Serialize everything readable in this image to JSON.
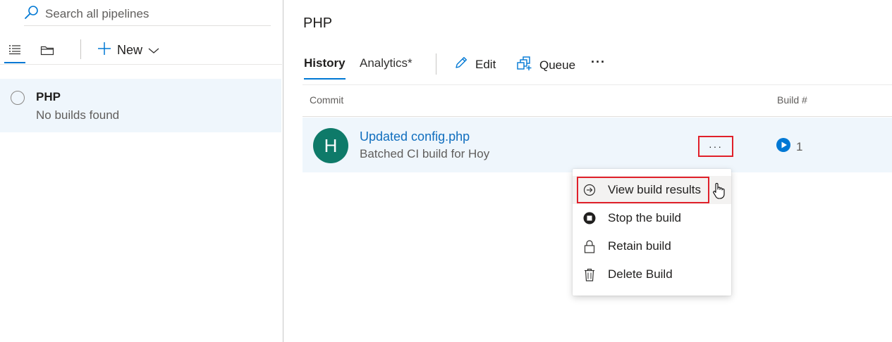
{
  "left_pane": {
    "search": {
      "placeholder": "Search all pipelines",
      "icon": "search-icon"
    },
    "view_toggles": [
      {
        "name": "list-view",
        "icon": "list-icon",
        "active": true
      },
      {
        "name": "folder-view",
        "icon": "folder-icon",
        "active": false
      }
    ],
    "new_button": {
      "label": "New",
      "icon": "plus-icon",
      "caret": "chevron-down-icon"
    },
    "pipelines": [
      {
        "name": "PHP",
        "subtitle": "No builds found",
        "status_icon": "circle-status-icon"
      }
    ]
  },
  "main": {
    "title": "PHP",
    "tabs": [
      {
        "label": "History",
        "active": true
      },
      {
        "label": "Analytics*",
        "active": false
      }
    ],
    "actions": {
      "edit": {
        "label": "Edit",
        "icon": "pencil-icon"
      },
      "queue": {
        "label": "Queue",
        "icon": "queue-icon"
      },
      "more": {
        "label": "···",
        "icon": "more-icon"
      }
    },
    "table": {
      "columns": {
        "commit": "Commit",
        "build": "Build #"
      },
      "rows": [
        {
          "avatar_letter": "H",
          "title": "Updated config.php",
          "subtitle": "Batched CI build for Hoy",
          "more_label": "···",
          "build_number": "1",
          "build_status_icon": "running-icon"
        }
      ]
    }
  },
  "context_menu": {
    "items": [
      {
        "label": "View build results",
        "icon": "arrow-circle-right-icon"
      },
      {
        "label": "Stop the build",
        "icon": "stop-icon"
      },
      {
        "label": "Retain build",
        "icon": "lock-icon"
      },
      {
        "label": "Delete Build",
        "icon": "trash-icon"
      }
    ]
  },
  "colors": {
    "accent": "#0078d4",
    "link": "#106ebe",
    "selection_bg": "#eff6fc",
    "avatar_bg": "#0e7a69",
    "highlight_border": "#e0202a"
  }
}
